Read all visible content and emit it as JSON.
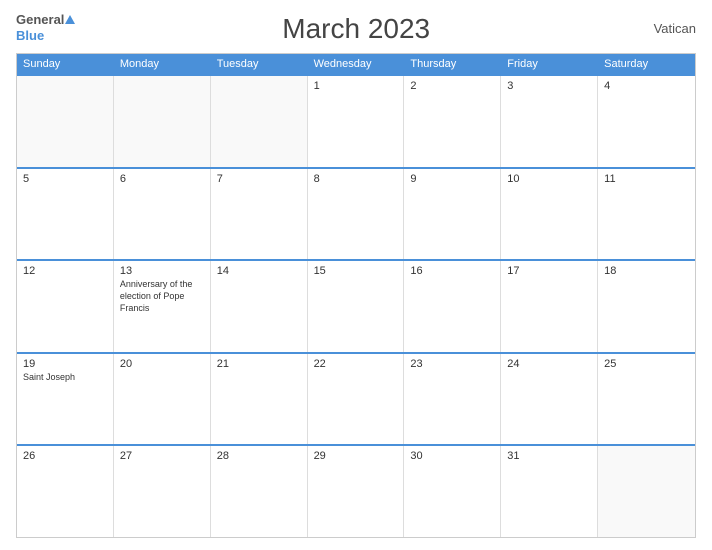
{
  "header": {
    "logo_general": "General",
    "logo_blue": "Blue",
    "title": "March 2023",
    "country": "Vatican"
  },
  "calendar": {
    "day_headers": [
      "Sunday",
      "Monday",
      "Tuesday",
      "Wednesday",
      "Thursday",
      "Friday",
      "Saturday"
    ],
    "weeks": [
      {
        "days": [
          {
            "num": "",
            "empty": true
          },
          {
            "num": "",
            "empty": true
          },
          {
            "num": "1",
            "event": ""
          },
          {
            "num": "2",
            "event": ""
          },
          {
            "num": "3",
            "event": ""
          },
          {
            "num": "4",
            "event": ""
          }
        ],
        "leading_empty": 2
      }
    ],
    "cells": [
      {
        "num": "",
        "empty": true,
        "event": ""
      },
      {
        "num": "",
        "empty": true,
        "event": ""
      },
      {
        "num": "1",
        "event": ""
      },
      {
        "num": "2",
        "event": ""
      },
      {
        "num": "3",
        "event": ""
      },
      {
        "num": "4",
        "event": ""
      },
      {
        "num": "5",
        "event": ""
      },
      {
        "num": "6",
        "event": ""
      },
      {
        "num": "7",
        "event": ""
      },
      {
        "num": "8",
        "event": ""
      },
      {
        "num": "9",
        "event": ""
      },
      {
        "num": "10",
        "event": ""
      },
      {
        "num": "11",
        "event": ""
      },
      {
        "num": "12",
        "event": ""
      },
      {
        "num": "13",
        "event": "Anniversary of the election of Pope Francis"
      },
      {
        "num": "14",
        "event": ""
      },
      {
        "num": "15",
        "event": ""
      },
      {
        "num": "16",
        "event": ""
      },
      {
        "num": "17",
        "event": ""
      },
      {
        "num": "18",
        "event": ""
      },
      {
        "num": "19",
        "event": ""
      },
      {
        "num": "20",
        "event": ""
      },
      {
        "num": "21",
        "event": ""
      },
      {
        "num": "22",
        "event": ""
      },
      {
        "num": "23",
        "event": ""
      },
      {
        "num": "24",
        "event": ""
      },
      {
        "num": "25",
        "event": ""
      },
      {
        "num": "26",
        "event": ""
      },
      {
        "num": "27",
        "event": ""
      },
      {
        "num": "28",
        "event": ""
      },
      {
        "num": "29",
        "event": ""
      },
      {
        "num": "30",
        "event": ""
      },
      {
        "num": "31",
        "event": ""
      },
      {
        "num": "",
        "empty": true,
        "event": ""
      },
      {
        "num": "",
        "empty": true,
        "event": ""
      },
      {
        "num": "",
        "empty": true,
        "event": ""
      }
    ],
    "week19_event": "Saint Joseph"
  }
}
